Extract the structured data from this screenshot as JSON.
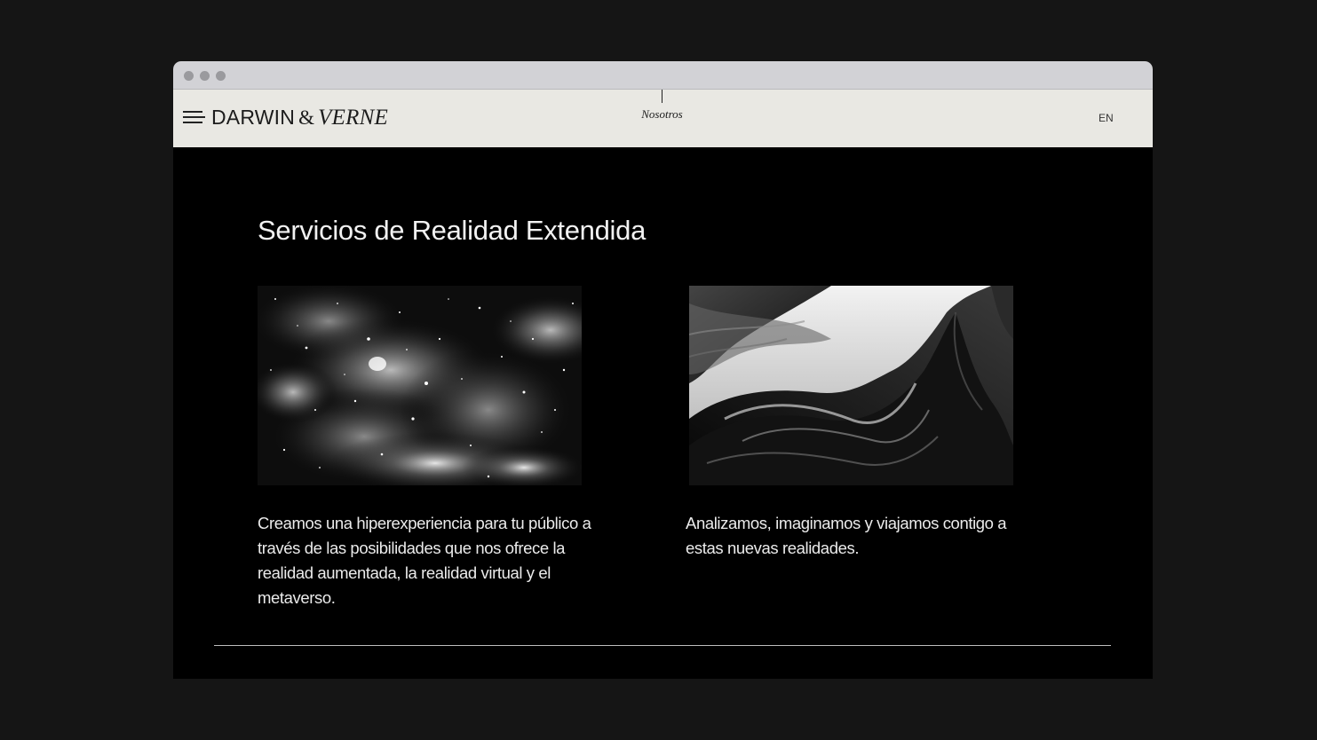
{
  "browser": {
    "window_controls": [
      "close",
      "minimize",
      "maximize"
    ]
  },
  "nav": {
    "menu_icon": "hamburger-menu-icon",
    "logo": {
      "part1": "DARWIN",
      "ampersand": "&",
      "part2": "VERNE"
    },
    "current_section": "Nosotros",
    "language": "EN"
  },
  "main": {
    "heading": "Servicios de Realidad Extendida",
    "cards": [
      {
        "image": "galaxy-nebula-image",
        "text": "Creamos una hiperexperiencia para tu público a través de las posibilidades que nos ofrece la realidad aumentada, la realidad virtual y el metaverso."
      },
      {
        "image": "sandstone-canyon-image",
        "text": "Analizamos, imaginamos y viajamos contigo a estas nuevas realidades."
      }
    ]
  },
  "colors": {
    "page_background": "#151515",
    "content_background": "#000000",
    "navbar_background": "#e9e8e3",
    "titlebar": "#d2d2d6",
    "text_light": "#ebebeb",
    "text_dark": "#1c1c1c"
  }
}
